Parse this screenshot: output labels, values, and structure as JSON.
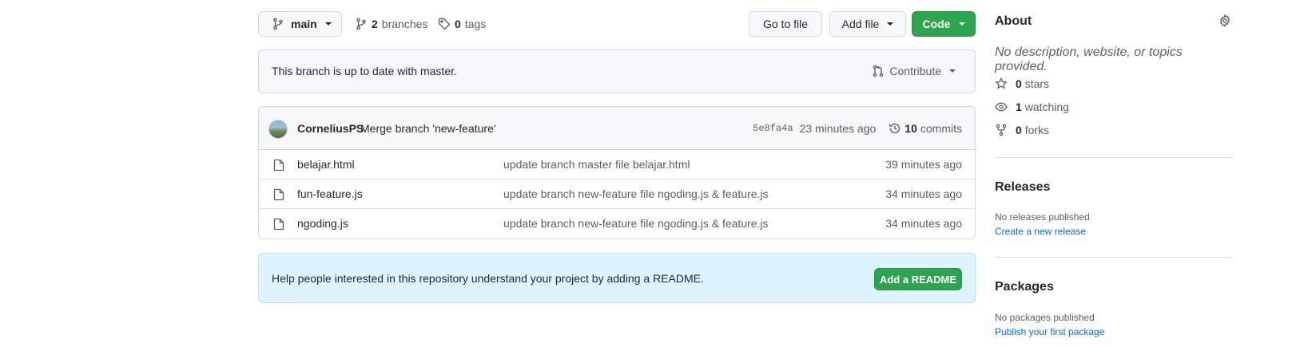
{
  "toolbar": {
    "branch_label": "main",
    "branches_count": "2",
    "branches_word": "branches",
    "tags_count": "0",
    "tags_word": "tags",
    "goto_file_label": "Go to file",
    "add_file_label": "Add file",
    "code_label": "Code"
  },
  "status": {
    "text": "This branch is up to date with master.",
    "contribute_label": "Contribute"
  },
  "commit": {
    "author": "CorneliusPS",
    "message": "Merge branch 'new-feature'",
    "sha": "5e8fa4a",
    "time": "23 minutes ago",
    "commits_count": "10",
    "commits_word": "commits"
  },
  "files": [
    {
      "name": "belajar.html",
      "message": "update branch master file belajar.html",
      "time": "39 minutes ago"
    },
    {
      "name": "fun-feature.js",
      "message": "update branch new-feature file ngoding.js & feature.js",
      "time": "34 minutes ago"
    },
    {
      "name": "ngoding.js",
      "message": "update branch new-feature file ngoding.js & feature.js",
      "time": "34 minutes ago"
    }
  ],
  "readme": {
    "text": "Help people interested in this repository understand your project by adding a README.",
    "button_label": "Add a README"
  },
  "sidebar": {
    "about_title": "About",
    "about_desc": "No description, website, or topics provided.",
    "stars_count": "0",
    "stars_word": "stars",
    "watching_count": "1",
    "watching_word": "watching",
    "forks_count": "0",
    "forks_word": "forks",
    "releases_title": "Releases",
    "no_releases": "No releases published",
    "create_release": "Create a new release",
    "packages_title": "Packages",
    "no_packages": "No packages published",
    "publish_package": "Publish your first package"
  },
  "colors": {
    "primary_green": "#2da44e",
    "link_blue": "#0969da",
    "readme_bg": "#ddf4ff"
  }
}
